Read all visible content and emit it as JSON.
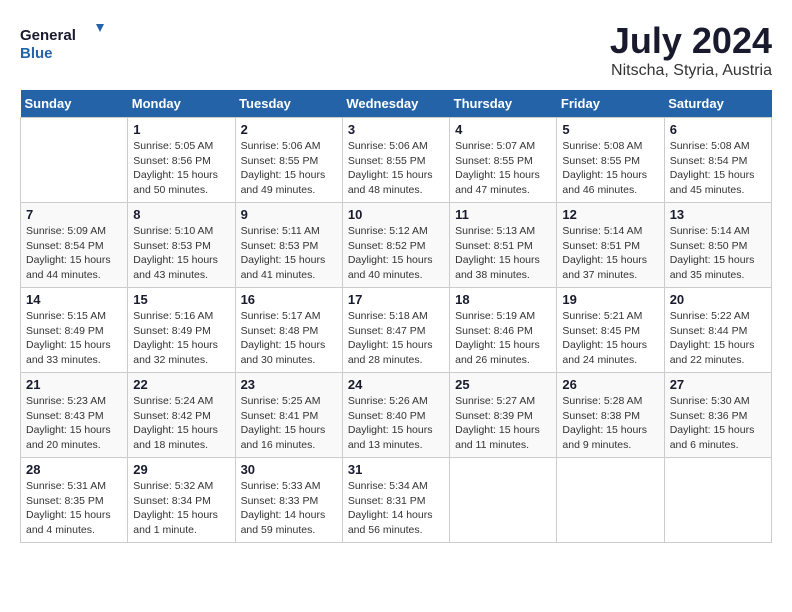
{
  "logo": {
    "line1": "General",
    "line2": "Blue"
  },
  "title": "July 2024",
  "subtitle": "Nitscha, Styria, Austria",
  "days_header": [
    "Sunday",
    "Monday",
    "Tuesday",
    "Wednesday",
    "Thursday",
    "Friday",
    "Saturday"
  ],
  "weeks": [
    [
      {
        "num": "",
        "info": ""
      },
      {
        "num": "1",
        "info": "Sunrise: 5:05 AM\nSunset: 8:56 PM\nDaylight: 15 hours\nand 50 minutes."
      },
      {
        "num": "2",
        "info": "Sunrise: 5:06 AM\nSunset: 8:55 PM\nDaylight: 15 hours\nand 49 minutes."
      },
      {
        "num": "3",
        "info": "Sunrise: 5:06 AM\nSunset: 8:55 PM\nDaylight: 15 hours\nand 48 minutes."
      },
      {
        "num": "4",
        "info": "Sunrise: 5:07 AM\nSunset: 8:55 PM\nDaylight: 15 hours\nand 47 minutes."
      },
      {
        "num": "5",
        "info": "Sunrise: 5:08 AM\nSunset: 8:55 PM\nDaylight: 15 hours\nand 46 minutes."
      },
      {
        "num": "6",
        "info": "Sunrise: 5:08 AM\nSunset: 8:54 PM\nDaylight: 15 hours\nand 45 minutes."
      }
    ],
    [
      {
        "num": "7",
        "info": "Sunrise: 5:09 AM\nSunset: 8:54 PM\nDaylight: 15 hours\nand 44 minutes."
      },
      {
        "num": "8",
        "info": "Sunrise: 5:10 AM\nSunset: 8:53 PM\nDaylight: 15 hours\nand 43 minutes."
      },
      {
        "num": "9",
        "info": "Sunrise: 5:11 AM\nSunset: 8:53 PM\nDaylight: 15 hours\nand 41 minutes."
      },
      {
        "num": "10",
        "info": "Sunrise: 5:12 AM\nSunset: 8:52 PM\nDaylight: 15 hours\nand 40 minutes."
      },
      {
        "num": "11",
        "info": "Sunrise: 5:13 AM\nSunset: 8:51 PM\nDaylight: 15 hours\nand 38 minutes."
      },
      {
        "num": "12",
        "info": "Sunrise: 5:14 AM\nSunset: 8:51 PM\nDaylight: 15 hours\nand 37 minutes."
      },
      {
        "num": "13",
        "info": "Sunrise: 5:14 AM\nSunset: 8:50 PM\nDaylight: 15 hours\nand 35 minutes."
      }
    ],
    [
      {
        "num": "14",
        "info": "Sunrise: 5:15 AM\nSunset: 8:49 PM\nDaylight: 15 hours\nand 33 minutes."
      },
      {
        "num": "15",
        "info": "Sunrise: 5:16 AM\nSunset: 8:49 PM\nDaylight: 15 hours\nand 32 minutes."
      },
      {
        "num": "16",
        "info": "Sunrise: 5:17 AM\nSunset: 8:48 PM\nDaylight: 15 hours\nand 30 minutes."
      },
      {
        "num": "17",
        "info": "Sunrise: 5:18 AM\nSunset: 8:47 PM\nDaylight: 15 hours\nand 28 minutes."
      },
      {
        "num": "18",
        "info": "Sunrise: 5:19 AM\nSunset: 8:46 PM\nDaylight: 15 hours\nand 26 minutes."
      },
      {
        "num": "19",
        "info": "Sunrise: 5:21 AM\nSunset: 8:45 PM\nDaylight: 15 hours\nand 24 minutes."
      },
      {
        "num": "20",
        "info": "Sunrise: 5:22 AM\nSunset: 8:44 PM\nDaylight: 15 hours\nand 22 minutes."
      }
    ],
    [
      {
        "num": "21",
        "info": "Sunrise: 5:23 AM\nSunset: 8:43 PM\nDaylight: 15 hours\nand 20 minutes."
      },
      {
        "num": "22",
        "info": "Sunrise: 5:24 AM\nSunset: 8:42 PM\nDaylight: 15 hours\nand 18 minutes."
      },
      {
        "num": "23",
        "info": "Sunrise: 5:25 AM\nSunset: 8:41 PM\nDaylight: 15 hours\nand 16 minutes."
      },
      {
        "num": "24",
        "info": "Sunrise: 5:26 AM\nSunset: 8:40 PM\nDaylight: 15 hours\nand 13 minutes."
      },
      {
        "num": "25",
        "info": "Sunrise: 5:27 AM\nSunset: 8:39 PM\nDaylight: 15 hours\nand 11 minutes."
      },
      {
        "num": "26",
        "info": "Sunrise: 5:28 AM\nSunset: 8:38 PM\nDaylight: 15 hours\nand 9 minutes."
      },
      {
        "num": "27",
        "info": "Sunrise: 5:30 AM\nSunset: 8:36 PM\nDaylight: 15 hours\nand 6 minutes."
      }
    ],
    [
      {
        "num": "28",
        "info": "Sunrise: 5:31 AM\nSunset: 8:35 PM\nDaylight: 15 hours\nand 4 minutes."
      },
      {
        "num": "29",
        "info": "Sunrise: 5:32 AM\nSunset: 8:34 PM\nDaylight: 15 hours\nand 1 minute."
      },
      {
        "num": "30",
        "info": "Sunrise: 5:33 AM\nSunset: 8:33 PM\nDaylight: 14 hours\nand 59 minutes."
      },
      {
        "num": "31",
        "info": "Sunrise: 5:34 AM\nSunset: 8:31 PM\nDaylight: 14 hours\nand 56 minutes."
      },
      {
        "num": "",
        "info": ""
      },
      {
        "num": "",
        "info": ""
      },
      {
        "num": "",
        "info": ""
      }
    ]
  ]
}
